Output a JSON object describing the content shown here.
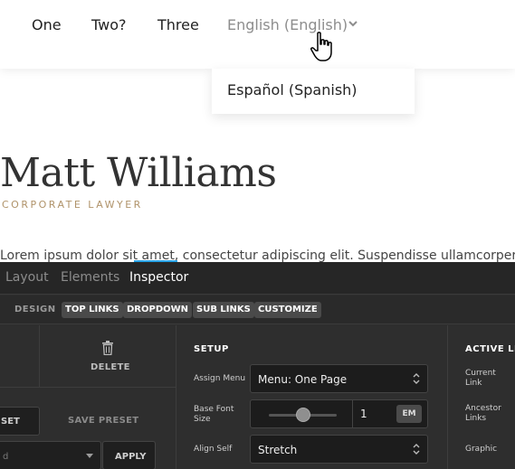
{
  "nav": {
    "items": [
      "One",
      "Two?",
      "Three"
    ],
    "language_label": "English (English)",
    "dropdown_option": "Español (Spanish)"
  },
  "profile": {
    "name": "Matt Williams",
    "title": "CORPORATE LAWYER",
    "intro": "Lorem ipsum dolor sit amet, consectetur adipiscing elit. Suspendisse ullamcorper temp"
  },
  "editor": {
    "tabs": [
      "Layout",
      "Elements",
      "Inspector"
    ],
    "active_tab": "Inspector",
    "subtab_label": "DESIGN",
    "subtabs": [
      "TOP LINKS",
      "DROPDOWN",
      "SUB LINKS",
      "CUSTOMIZE"
    ],
    "delete_label": "DELETE",
    "reset_label": "SET",
    "save_preset_label": "SAVE PRESET",
    "preset_value": "d",
    "apply_label": "APPLY",
    "setup": {
      "title": "SETUP",
      "assign_menu_label": "Assign Menu",
      "assign_menu_value": "Menu: One Page",
      "base_font_label": "Base Font Size",
      "base_font_value": "1",
      "base_font_unit": "EM",
      "base_font_slider_level": 0.5,
      "align_self_label": "Align Self",
      "align_self_value": "Stretch"
    },
    "active_links": {
      "title": "ACTIVE LIN",
      "current_label": "Current Link",
      "ancestor_label": "Ancestor Links",
      "graphic_label": "Graphic"
    }
  },
  "colors": {
    "accent": "#29a3e6",
    "subtitle": "#b0936a",
    "panel_bg": "#2e2e2e"
  }
}
